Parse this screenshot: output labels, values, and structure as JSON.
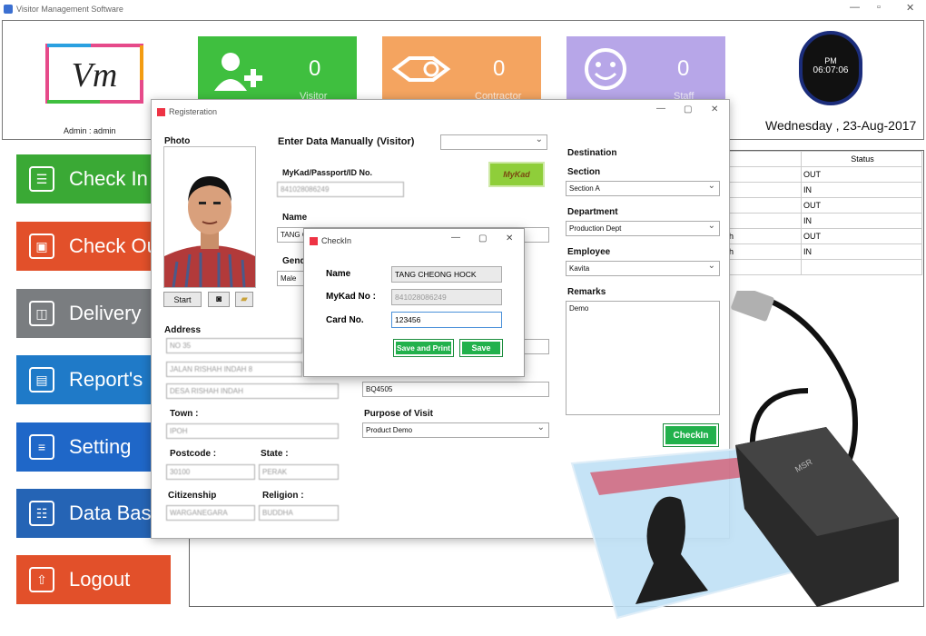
{
  "app": {
    "title": "Visitor Management Software",
    "admin_label": "Admin : admin",
    "logo_text": "Vm"
  },
  "tiles": [
    {
      "count": "0",
      "label": "Visitor",
      "color": "#3fbf3f"
    },
    {
      "count": "0",
      "label": "Contractor",
      "color": "#f4a460"
    },
    {
      "count": "0",
      "label": "Staff",
      "color": "#b7a6e8"
    }
  ],
  "clock": {
    "ampm": "PM",
    "time": "06:07:06"
  },
  "date": "Wednesday , 23-Aug-2017",
  "menu": [
    {
      "label": "Check In",
      "icon": "address-book-icon",
      "color": "#3aa935"
    },
    {
      "label": "Check Out",
      "icon": "contact-card-icon",
      "color": "#e2502a"
    },
    {
      "label": "Delivery",
      "icon": "shopping-bag-icon",
      "color": "#7a7d80"
    },
    {
      "label": "Report's",
      "icon": "newspaper-icon",
      "color": "#1f7ac8"
    },
    {
      "label": "Setting",
      "icon": "sliders-icon",
      "color": "#1f67c8"
    },
    {
      "label": "Data Base",
      "icon": "server-icon",
      "color": "#2564b5"
    },
    {
      "label": "Logout",
      "icon": "upload-icon",
      "color": "#e2502a"
    }
  ],
  "status_table": {
    "header": "Status",
    "rows": [
      {
        "left": "",
        "status": "OUT"
      },
      {
        "left": "",
        "status": "IN"
      },
      {
        "left": "",
        "status": "OUT"
      },
      {
        "left": "",
        "status": "IN"
      },
      {
        "left": "h",
        "status": "OUT"
      },
      {
        "left": "h",
        "status": "IN"
      },
      {
        "left": "",
        "status": ""
      }
    ]
  },
  "registration": {
    "title": "Registeration",
    "photo_label": "Photo",
    "start_label": "Start",
    "enter_manually": "Enter Data Manually",
    "visitor_type": "(Visitor)",
    "mykad_label": "MyKad/Passport/ID No.",
    "mykad_value": "841028086249",
    "mykad_button": "MyKad",
    "name_label": "Name",
    "name_value": "TANG C",
    "gender_label": "Gend",
    "gender_value": "Male",
    "address_label": "Address",
    "address_1": "NO 35",
    "address_2": "JALAN RISHAH INDAH 8",
    "address_3": "DESA RISHAH INDAH",
    "town_label": "Town :",
    "town_value": "IPOH",
    "postcode_label": "Postcode :",
    "postcode_value": "30100",
    "state_label": "State :",
    "state_value": "PERAK",
    "citizenship_label": "Citizenship",
    "citizenship_value": "WARGANEGARA",
    "religion_label": "Religion :",
    "religion_value": "BUDDHA",
    "vehicle_value": "BQ4505",
    "purpose_label": "Purpose of Visit",
    "purpose_value": "Product Demo",
    "destination_label": "Destination",
    "section_label": "Section",
    "section_value": "Section A",
    "department_label": "Department",
    "department_value": "Production Dept",
    "employee_label": "Employee",
    "employee_value": "Kavita",
    "remarks_label": "Remarks",
    "remarks_value": "Demo",
    "checkin_button": "CheckIn"
  },
  "checkin_dialog": {
    "title": "CheckIn",
    "name_label": "Name",
    "name_value": "TANG CHEONG HOCK",
    "mykad_label": "MyKad No :",
    "mykad_value": "841028086249",
    "card_label": "Card No.",
    "card_value": "123456",
    "save_print": "Save and Print",
    "save": "Save"
  },
  "card_reader": {
    "brand": "MSR"
  }
}
